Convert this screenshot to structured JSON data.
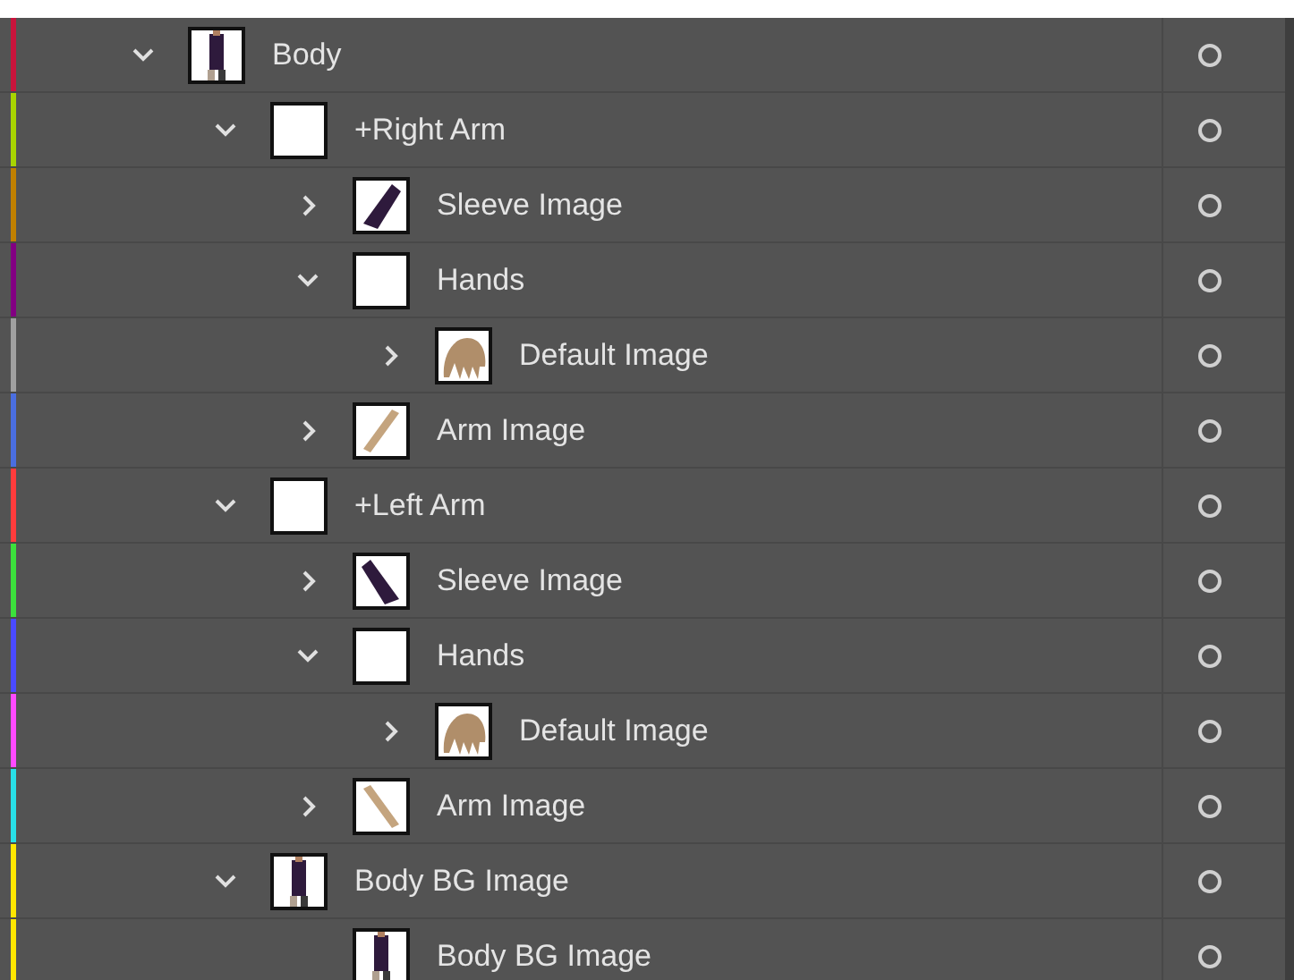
{
  "layers": [
    {
      "name": "Body",
      "kind": "figure",
      "color": "#c8143c",
      "expanded": true,
      "children": [
        {
          "name": "+Right Arm",
          "kind": "empty",
          "color": "#a8d400",
          "expanded": true,
          "children": [
            {
              "name": "Sleeve Image",
              "kind": "sleeve",
              "flipped": false,
              "color": "#c08000",
              "expanded": false
            },
            {
              "name": "Hands",
              "kind": "empty",
              "color": "#820082",
              "expanded": true,
              "children": [
                {
                  "name": "Default Image",
                  "kind": "hand",
                  "color": "#a0a0a0",
                  "expanded": false
                }
              ]
            },
            {
              "name": "Arm Image",
              "kind": "arm",
              "flipped": false,
              "color": "#4a6ee0",
              "expanded": false
            }
          ]
        },
        {
          "name": "+Left Arm",
          "kind": "empty",
          "color": "#ff3c3c",
          "expanded": true,
          "children": [
            {
              "name": "Sleeve Image",
              "kind": "sleeve",
              "flipped": true,
              "color": "#3ce03c",
              "expanded": false
            },
            {
              "name": "Hands",
              "kind": "empty",
              "color": "#4a4aff",
              "expanded": true,
              "children": [
                {
                  "name": "Default Image",
                  "kind": "hand",
                  "color": "#ff4aff",
                  "expanded": false
                }
              ]
            },
            {
              "name": "Arm Image",
              "kind": "arm",
              "flipped": true,
              "color": "#28e0e8",
              "expanded": false
            }
          ]
        },
        {
          "name": "Body BG Image",
          "kind": "figure",
          "color": "#ffe600",
          "expanded": true,
          "children": [
            {
              "name": "Body BG Image",
              "kind": "figure",
              "color": "#ffe600"
            }
          ]
        }
      ]
    }
  ]
}
